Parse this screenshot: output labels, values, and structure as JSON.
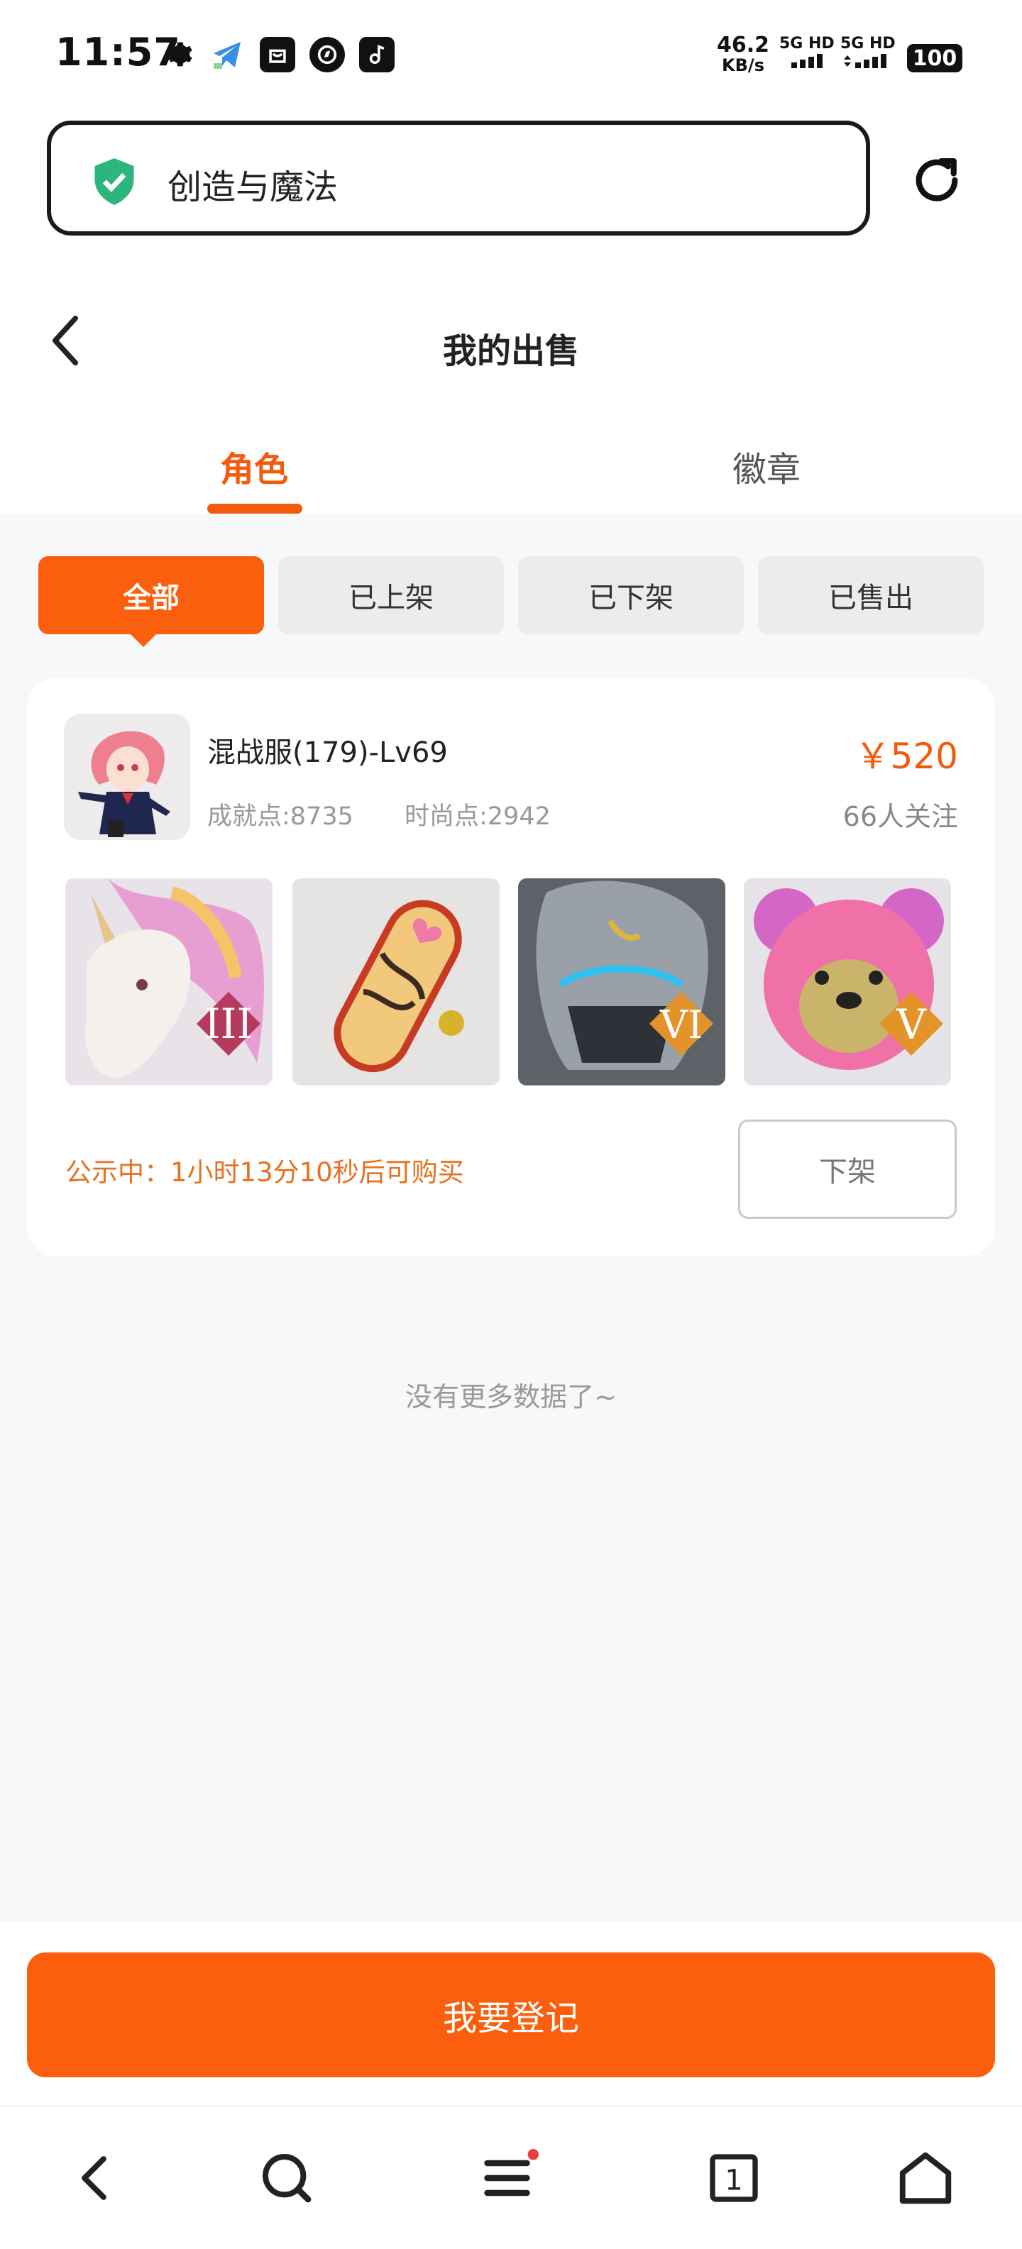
{
  "status_bar": {
    "time": "11:57",
    "net_speed": "46.2",
    "net_unit": "KB/s",
    "sim1": "5G HD",
    "sim2": "5G HD",
    "battery": "100"
  },
  "browser": {
    "url_text": "创造与魔法"
  },
  "header": {
    "title": "我的出售"
  },
  "tabs": [
    {
      "label": "角色",
      "active": true
    },
    {
      "label": "徽章",
      "active": false
    }
  ],
  "filters": [
    {
      "label": "全部",
      "active": true
    },
    {
      "label": "已上架",
      "active": false
    },
    {
      "label": "已下架",
      "active": false
    },
    {
      "label": "已售出",
      "active": false
    }
  ],
  "listing": {
    "name": "混战服(179)-Lv69",
    "achievement": "成就点:8735",
    "fashion": "时尚点:2942",
    "price": "￥520",
    "followers": "66人关注",
    "items": [
      {
        "icon": "unicorn-mount",
        "tier": "III"
      },
      {
        "icon": "skateboard",
        "tier": ""
      },
      {
        "icon": "armored-beast",
        "tier": "VI"
      },
      {
        "icon": "pink-bear",
        "tier": "V"
      }
    ],
    "notice": "公示中：1小时13分10秒后可购买",
    "unlist_label": "下架"
  },
  "footer_note": "没有更多数据了~",
  "register_label": "我要登记",
  "nav": {
    "tab_count": "1"
  },
  "colors": {
    "accent": "#fb5e0c",
    "accent_text": "#f35b0c",
    "notice": "#e8701f"
  }
}
